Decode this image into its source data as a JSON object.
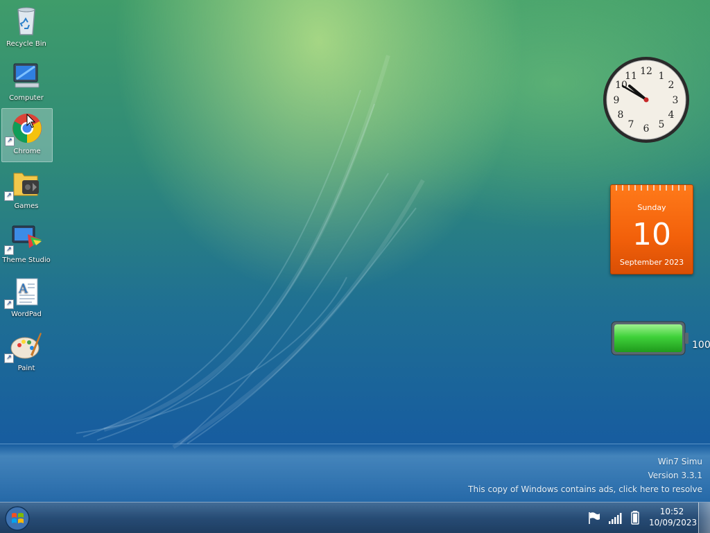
{
  "desktop": {
    "icons": [
      {
        "label": "Recycle Bin",
        "icon": "recycle-bin-icon",
        "shortcut": false
      },
      {
        "label": "Computer",
        "icon": "computer-icon",
        "shortcut": false
      },
      {
        "label": "Chrome",
        "icon": "chrome-icon",
        "shortcut": true,
        "selected": true
      },
      {
        "label": "Games",
        "icon": "games-folder-icon",
        "shortcut": true
      },
      {
        "label": "Theme Studio",
        "icon": "theme-studio-icon",
        "shortcut": true
      },
      {
        "label": "WordPad",
        "icon": "wordpad-icon",
        "shortcut": true
      },
      {
        "label": "Paint",
        "icon": "paint-icon",
        "shortcut": true
      }
    ]
  },
  "gadgets": {
    "clock": {
      "time": "10:52",
      "numerals": [
        "12",
        "1",
        "2",
        "3",
        "4",
        "5",
        "6",
        "7",
        "8",
        "9",
        "10",
        "11"
      ]
    },
    "calendar": {
      "weekday": "Sunday",
      "day": "10",
      "month_year": "September 2023"
    },
    "battery": {
      "level_percent": 100,
      "label": "100"
    }
  },
  "watermark": {
    "line1": "Win7 Simu",
    "line2": "Version 3.3.1",
    "line3": "This copy of Windows contains ads, click here to resolve"
  },
  "taskbar": {
    "start_icon": "windows-start-orb-icon",
    "tray": {
      "icons": [
        "action-center-flag-icon",
        "network-signal-icon",
        "battery-icon"
      ],
      "time": "10:52",
      "date": "10/09/2023"
    }
  },
  "colors": {
    "calendar_orange": "#f2600a",
    "battery_green": "#3fd13a",
    "taskbar_blue": "#2f5a88"
  }
}
